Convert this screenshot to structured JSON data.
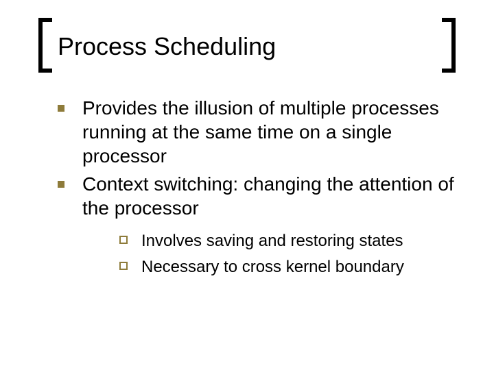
{
  "title": "Process Scheduling",
  "bullets": {
    "level1": [
      "Provides the illusion of multiple processes running at the same time on a single processor",
      "Context switching:  changing the attention of the processor"
    ],
    "level2": [
      "Involves saving and restoring states",
      "Necessary to cross kernel boundary"
    ]
  }
}
